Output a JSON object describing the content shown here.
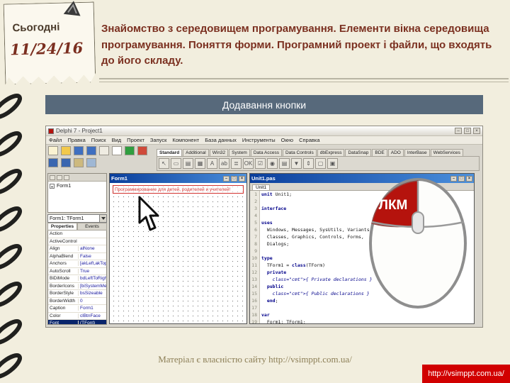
{
  "note": {
    "label": "Сьогодні",
    "date": "11/24/16"
  },
  "heading": {
    "text": "Знайомство з середовищем програмування. Елементи вікна середовища програмування. Поняття форми. Програмний проект і файли, що входять до його складу."
  },
  "banner": {
    "title": "Додавання кнопки"
  },
  "footer": {
    "credit": "Матеріал є власністю сайту http://vsimppt.com.ua/",
    "badge": "http://vsimppt.com.ua/"
  },
  "mouse": {
    "left_button_label": "ЛКМ",
    "button_color": "#b5130d"
  },
  "ide": {
    "title": "Delphi 7 - Project1",
    "window_buttons": [
      "–",
      "□",
      "×"
    ],
    "menus": [
      "Файл",
      "Правка",
      "Поиск",
      "Вид",
      "Проект",
      "Запуск",
      "Компонент",
      "База данных",
      "Инструменты",
      "Окно",
      "Справка"
    ],
    "toolbar_icons": [
      {
        "name": "new-file-icon",
        "color": "#fbf3d2"
      },
      {
        "name": "open-file-icon",
        "color": "#f2c94c"
      },
      {
        "name": "save-icon",
        "color": "#3f6fc0"
      },
      {
        "name": "save-all-icon",
        "color": "#3f6fc0"
      },
      {
        "name": "help-icon",
        "color": "#efece2"
      },
      {
        "name": "new-form-icon",
        "color": "#ffffff"
      },
      {
        "name": "run-icon",
        "color": "#2f9e3f"
      },
      {
        "name": "pause-icon",
        "color": "#cf4a3a"
      },
      {
        "name": "step-over-icon",
        "color": "#3a66b0"
      },
      {
        "name": "trace-into-icon",
        "color": "#3a66b0"
      },
      {
        "name": "view-unit-icon",
        "color": "#cdb97e"
      },
      {
        "name": "view-form-icon",
        "color": "#9fb7d4"
      }
    ],
    "palette_tabs": [
      {
        "label": "Standard",
        "sel": true
      },
      {
        "label": "Additional"
      },
      {
        "label": "Win32"
      },
      {
        "label": "System"
      },
      {
        "label": "Data Access"
      },
      {
        "label": "Data Controls"
      },
      {
        "label": "dbExpress"
      },
      {
        "label": "DataSnap"
      },
      {
        "label": "BDE"
      },
      {
        "label": "ADO"
      },
      {
        "label": "InterBase"
      },
      {
        "label": "WebServices"
      }
    ],
    "component_icons": [
      {
        "name": "pointer-icon",
        "glyph": "↖"
      },
      {
        "name": "frames-icon",
        "glyph": "▭"
      },
      {
        "name": "main-menu-icon",
        "glyph": "▤"
      },
      {
        "name": "popup-menu-icon",
        "glyph": "▦"
      },
      {
        "name": "label-icon",
        "glyph": "A"
      },
      {
        "name": "edit-icon",
        "glyph": "ab"
      },
      {
        "name": "memo-icon",
        "glyph": "≣"
      },
      {
        "name": "button-icon",
        "glyph": "OK"
      },
      {
        "name": "checkbox-icon",
        "glyph": "☑"
      },
      {
        "name": "radio-button-icon",
        "glyph": "◉"
      },
      {
        "name": "listbox-icon",
        "glyph": "▤"
      },
      {
        "name": "combobox-icon",
        "glyph": "▼"
      },
      {
        "name": "scrollbar-icon",
        "glyph": "⇕"
      },
      {
        "name": "groupbox-icon",
        "glyph": "▢"
      },
      {
        "name": "panel-icon",
        "glyph": "▣"
      }
    ],
    "tree": {
      "root": "Form1"
    },
    "inspector": {
      "object": "Form1: TForm1",
      "tabs": [
        {
          "label": "Properties",
          "sel": true
        },
        {
          "label": "Events"
        }
      ],
      "rows": [
        {
          "n": "Action",
          "v": ""
        },
        {
          "n": "ActiveControl",
          "v": ""
        },
        {
          "n": "Align",
          "v": "alNone"
        },
        {
          "n": "AlphaBlend",
          "v": "False"
        },
        {
          "n": "Anchors",
          "v": "[akLeft,akTop]"
        },
        {
          "n": "AutoScroll",
          "v": "True"
        },
        {
          "n": "BiDiMode",
          "v": "bdLeftToRight"
        },
        {
          "n": "BorderIcons",
          "v": "[biSystemMenu,biMin"
        },
        {
          "n": "BorderStyle",
          "v": "bsSizeable"
        },
        {
          "n": "BorderWidth",
          "v": "0"
        },
        {
          "n": "Caption",
          "v": "Form1"
        },
        {
          "n": "Color",
          "v": "clBtnFace"
        },
        {
          "n": "Font",
          "v": "(TFont)",
          "sel": true
        }
      ]
    },
    "form": {
      "caption": "Form1",
      "watermark": "Программирование для детей, родителей и учителей!"
    },
    "editor": {
      "title": "Unit1.pas",
      "tab": "Unit1",
      "lines": [
        "unit Unit1;",
        "",
        "interface",
        "",
        "uses",
        "  Windows, Messages, SysUtils, Variants,",
        "  Classes, Graphics, Controls, Forms,",
        "  Dialogs;",
        "",
        "type",
        "  TForm1 = class(TForm)",
        "  private",
        "    { Private declarations }",
        "  public",
        "    { Public declarations }",
        "  end;",
        "",
        "var",
        "  Form1: TForm1;"
      ]
    }
  }
}
